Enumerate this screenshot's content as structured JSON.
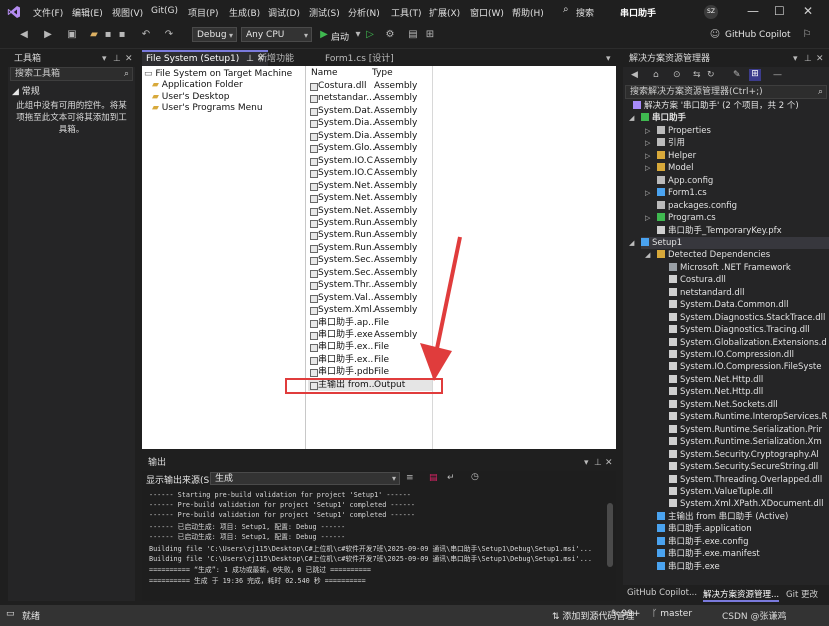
{
  "menu": {
    "items": [
      "文件(F)",
      "编辑(E)",
      "视图(V)",
      "Git(G)",
      "项目(P)",
      "生成(B)",
      "调试(D)",
      "测试(S)",
      "分析(N)",
      "工具(T)",
      "扩展(X)",
      "窗口(W)",
      "帮助(H)"
    ],
    "search": "搜索",
    "solution_name": "串口助手",
    "avatar": "SZ",
    "copilot": "GitHub Copilot"
  },
  "toolbar": {
    "config": "Debug",
    "platform": "Any CPU",
    "start": "启动"
  },
  "toolbox": {
    "title": "工具箱",
    "search_placeholder": "搜索工具箱",
    "group": "常规",
    "empty_message": "此组中没有可用的控件。将某项拖至此文本可将其添加到工具箱。"
  },
  "tabs": [
    {
      "label": "File System (Setup1)"
    },
    {
      "label": "新增功能"
    },
    {
      "label": "Form1.cs [设计]"
    }
  ],
  "fs": {
    "root": "File System on Target Machine",
    "folders": [
      "Application Folder",
      "User's Desktop",
      "User's Programs Menu"
    ],
    "col_name": "Name",
    "col_type": "Type",
    "rows": [
      {
        "name": "Costura.dll",
        "type": "Assembly"
      },
      {
        "name": "netstandar...",
        "type": "Assembly"
      },
      {
        "name": "System.Dat...",
        "type": "Assembly"
      },
      {
        "name": "System.Dia...",
        "type": "Assembly"
      },
      {
        "name": "System.Dia...",
        "type": "Assembly"
      },
      {
        "name": "System.Glo...",
        "type": "Assembly"
      },
      {
        "name": "System.IO.C...",
        "type": "Assembly"
      },
      {
        "name": "System.IO.C...",
        "type": "Assembly"
      },
      {
        "name": "System.Net...",
        "type": "Assembly"
      },
      {
        "name": "System.Net...",
        "type": "Assembly"
      },
      {
        "name": "System.Net...",
        "type": "Assembly"
      },
      {
        "name": "System.Run...",
        "type": "Assembly"
      },
      {
        "name": "System.Run...",
        "type": "Assembly"
      },
      {
        "name": "System.Run...",
        "type": "Assembly"
      },
      {
        "name": "System.Sec...",
        "type": "Assembly"
      },
      {
        "name": "System.Sec...",
        "type": "Assembly"
      },
      {
        "name": "System.Thr...",
        "type": "Assembly"
      },
      {
        "name": "System.Val...",
        "type": "Assembly"
      },
      {
        "name": "System.Xml...",
        "type": "Assembly"
      },
      {
        "name": "串口助手.ap...",
        "type": "File"
      },
      {
        "name": "串口助手.exe",
        "type": "Assembly"
      },
      {
        "name": "串口助手.ex...",
        "type": "File"
      },
      {
        "name": "串口助手.ex...",
        "type": "File"
      },
      {
        "name": "串口助手.pdb",
        "type": "File"
      },
      {
        "name": "主输出 from...",
        "type": "Output"
      }
    ]
  },
  "output": {
    "title": "输出",
    "source_label": "显示输出来源(S):",
    "source_value": "生成",
    "lines": [
      "------ Starting pre-build validation for project 'Setup1' ------",
      "------ Pre-build validation for project 'Setup1' completed ------",
      "------ Pre-build validation for project 'Setup1' completed ------",
      "------ 已启动生成: 项目: Setup1, 配置: Debug ------",
      "------ 已启动生成: 项目: Setup1, 配置: Debug ------",
      "Building file 'C:\\Users\\zj115\\Desktop\\C#上位机\\c#软件开发7班\\2025-09-09 通讯\\串口助手\\Setup1\\Debug\\Setup1.msi'...",
      "Building file 'C:\\Users\\zj115\\Desktop\\C#上位机\\c#软件开发7班\\2025-09-09 通讯\\串口助手\\Setup1\\Debug\\Setup1.msi'...",
      "========== “生成”: 1 成功或最新，0失败，0 已跳过 ==========",
      "========== 生成 于 19:36 完成，耗时 02.540 秒 =========="
    ]
  },
  "solution_explorer": {
    "title": "解决方案资源管理器",
    "search_placeholder": "搜索解决方案资源管理器(Ctrl+;)",
    "solution_label": "解决方案 '串口助手' (2 个项目，共 2 个)",
    "project1": "串口助手",
    "project1_items": [
      "Properties",
      "引用",
      "Helper",
      "Model",
      "App.config",
      "Form1.cs",
      "packages.config",
      "Program.cs",
      "串口助手_TemporaryKey.pfx"
    ],
    "project2": "Setup1",
    "detected": "Detected Dependencies",
    "deps": [
      "Microsoft .NET Framework",
      "Costura.dll",
      "netstandard.dll",
      "System.Data.Common.dll",
      "System.Diagnostics.StackTrace.dll",
      "System.Diagnostics.Tracing.dll",
      "System.Globalization.Extensions.d",
      "System.IO.Compression.dll",
      "System.IO.Compression.FileSyste",
      "System.Net.Http.dll",
      "System.Net.Http.dll",
      "System.Net.Sockets.dll",
      "System.Runtime.InteropServices.R",
      "System.Runtime.Serialization.Prir",
      "System.Runtime.Serialization.Xm",
      "System.Security.Cryptography.Al",
      "System.Security.SecureString.dll",
      "System.Threading.Overlapped.dll",
      "System.ValueTuple.dll",
      "System.Xml.XPath.XDocument.dll"
    ],
    "setup_items": [
      "主输出 from 串口助手 (Active)",
      "串口助手.application",
      "串口助手.exe.config",
      "串口助手.exe.manifest",
      "串口助手.exe"
    ],
    "bottom_tabs": [
      "GitHub Copilot...",
      "解决方案资源管理...",
      "Git 更改"
    ]
  },
  "status": {
    "ready": "就绪",
    "source_control": "添加到源代码管理",
    "errors": "99+",
    "branch": "master",
    "watermark": "CSDN @张谦鸡"
  },
  "colors": {
    "annotation_red": "#e03c3c",
    "accent": "#7a7adc"
  }
}
